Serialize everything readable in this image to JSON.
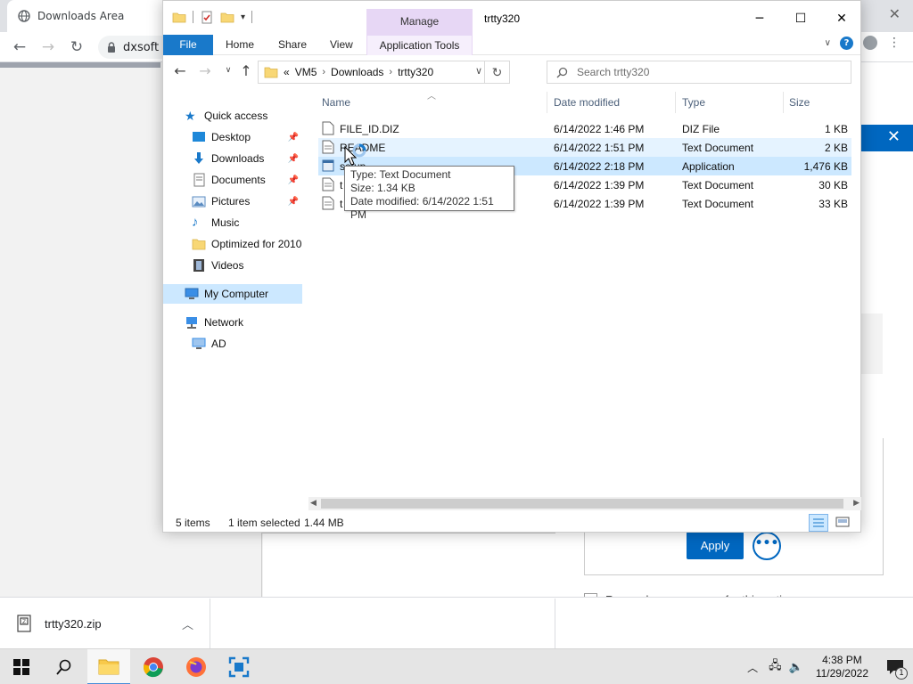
{
  "browser": {
    "tab_title": "Downloads Area",
    "url": "dxsoft",
    "close_tab": "✕"
  },
  "dialog": {
    "apply_label": "Apply",
    "more_label": "•••",
    "remember_label": "Remember my answer for this entire process."
  },
  "download_shelf": {
    "filename": "trtty320.zip"
  },
  "explorer": {
    "manage_tab": "Manage",
    "window_title": "trtty320",
    "ribbon_tabs": [
      "File",
      "Home",
      "Share",
      "View",
      "Application Tools"
    ],
    "breadcrumb": {
      "overflow": "«",
      "parts": [
        "VM5",
        "Downloads",
        "trtty320"
      ]
    },
    "search_placeholder": "Search trtty320",
    "nav": {
      "quick_access": "Quick access",
      "desktop": "Desktop",
      "downloads": "Downloads",
      "documents": "Documents",
      "pictures": "Pictures",
      "music": "Music",
      "optimized": "Optimized for 2010",
      "videos": "Videos",
      "my_computer": "My Computer",
      "network": "Network",
      "ad": "AD"
    },
    "columns": {
      "name": "Name",
      "date": "Date modified",
      "type": "Type",
      "size": "Size"
    },
    "files": [
      {
        "name": "FILE_ID.DIZ",
        "date": "6/14/2022 1:46 PM",
        "type": "DIZ File",
        "size": "1 KB"
      },
      {
        "name": "README",
        "date": "6/14/2022 1:51 PM",
        "type": "Text Document",
        "size": "2 KB"
      },
      {
        "name": "setup",
        "date": "6/14/2022 2:18 PM",
        "type": "Application",
        "size": "1,476 KB"
      },
      {
        "name": "t",
        "date": "6/14/2022 1:39 PM",
        "type": "Text Document",
        "size": "30 KB"
      },
      {
        "name": "t",
        "date": "6/14/2022 1:39 PM",
        "type": "Text Document",
        "size": "33 KB"
      }
    ],
    "tooltip": {
      "type_line": "Type: Text Document",
      "size_line": "Size: 1.34 KB",
      "date_line": "Date modified: 6/14/2022 1:51 PM"
    },
    "status": {
      "items": "5 items",
      "selected": "1 item selected",
      "selected_size": "1.44 MB"
    }
  },
  "taskbar": {
    "time": "4:38 PM",
    "date": "11/29/2022",
    "notification_count": "1"
  },
  "colors": {
    "accent": "#0067c0",
    "file_tab": "#1979ca",
    "manage_tab": "#e7d7f5",
    "selection": "#cce8ff",
    "hover": "#e5f3ff"
  }
}
